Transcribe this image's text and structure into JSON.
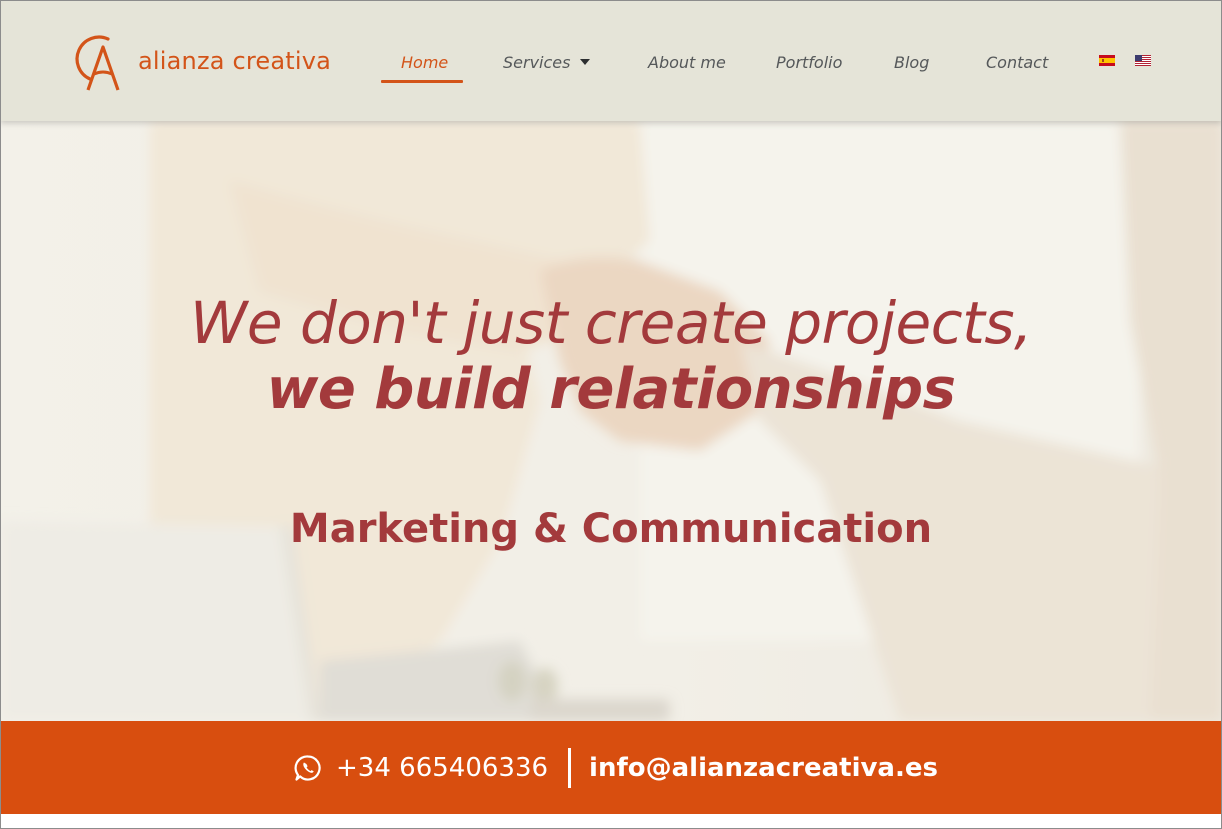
{
  "brand": {
    "name": "alianza creativa",
    "accent": "#d35419"
  },
  "nav": {
    "items": [
      {
        "label": "Home",
        "active": true
      },
      {
        "label": "Services",
        "has_dropdown": true
      },
      {
        "label": "About me"
      },
      {
        "label": "Portfolio"
      },
      {
        "label": "Blog"
      },
      {
        "label": "Contact"
      }
    ],
    "languages": [
      {
        "flag": "spain-flag-icon"
      },
      {
        "flag": "us-flag-icon"
      }
    ]
  },
  "hero": {
    "headline_line1": "We don't just create projects,",
    "headline_line2": "we build relationships",
    "subheadline": "Marketing & Communication",
    "text_color": "#a33a3c",
    "background": "handshake-photo"
  },
  "contact": {
    "phone": "+34 665406336",
    "email": "info@alianzacreativa.es",
    "bar_color": "#d84e0f",
    "phone_icon": "whatsapp-icon"
  }
}
